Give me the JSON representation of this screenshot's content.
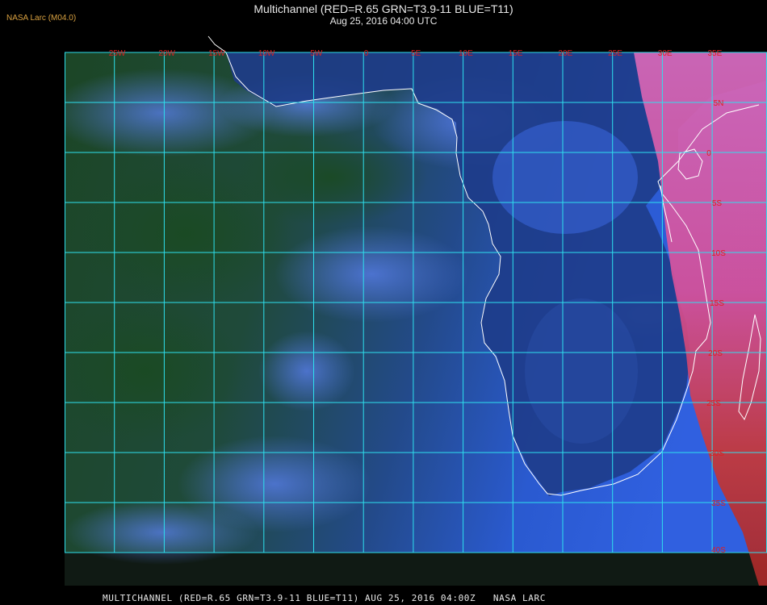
{
  "header": {
    "source_label": "NASA Larc (M04.0)",
    "title": "Multichannel (RED=R.65 GRN=T3.9-11 BLUE=T11)",
    "subtitle": "Aug 25, 2016 04:00 UTC"
  },
  "footer": {
    "caption": "MULTICHANNEL (RED=R.65 GRN=T3.9-11 BLUE=T11) AUG 25, 2016 04:00Z   NASA LARC"
  },
  "map": {
    "longitude_labels": [
      "25W",
      "20W",
      "15W",
      "10W",
      "5W",
      "0",
      "5E",
      "10E",
      "15E",
      "20E",
      "25E",
      "30E",
      "35E"
    ],
    "latitude_labels": [
      "5N",
      "0",
      "5S",
      "10S",
      "15S",
      "20S",
      "25S",
      "30S",
      "35S",
      "40S"
    ],
    "colors": {
      "grid": "#2ee0ee",
      "coastline": "#ffffff",
      "ocean_green": "#1f4a2a",
      "ocean_blue": "#2a58c8",
      "land_blue": "#1e3c8a",
      "east_africa_pink": "#d860a8",
      "east_africa_red": "#c83030",
      "label_red": "#e02020"
    }
  }
}
